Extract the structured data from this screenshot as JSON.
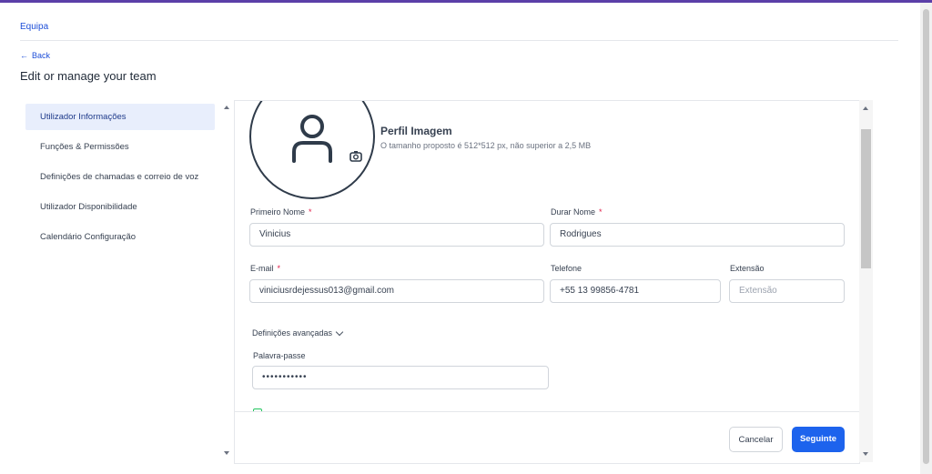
{
  "nav": {
    "tab": "Equipa",
    "back": "Back",
    "page_title": "Edit or manage your team"
  },
  "sidebar": {
    "items": [
      {
        "label": "Utilizador Informações",
        "active": true
      },
      {
        "label": "Funções & Permissões",
        "active": false
      },
      {
        "label": "Definições de chamadas e correio de voz",
        "active": false
      },
      {
        "label": "Utilizador Disponibilidade",
        "active": false
      },
      {
        "label": "Calendário Configuração",
        "active": false
      }
    ]
  },
  "profile": {
    "title": "Perfil Imagem",
    "subtitle": "O tamanho proposto é 512*512 px, não superior a 2,5 MB"
  },
  "form": {
    "first_name": {
      "label": "Primeiro Nome",
      "required_mark": "*",
      "value": "Vinicius"
    },
    "last_name": {
      "label": "Durar Nome",
      "required_mark": "*",
      "value": "Rodrigues"
    },
    "email": {
      "label": "E-mail",
      "required_mark": "*",
      "value": "viniciusrdejessus013@gmail.com"
    },
    "phone": {
      "label": "Telefone",
      "value": "+55 13 99856-4781"
    },
    "extension": {
      "label": "Extensão",
      "placeholder": "Extensão"
    },
    "advanced": {
      "label": "Definições avançadas"
    },
    "password": {
      "label": "Palavra-passe",
      "value": "•••••••••••"
    }
  },
  "footer": {
    "cancel": "Cancelar",
    "next": "Seguinte"
  },
  "colors": {
    "accent": "#1d63ed",
    "active_bg": "#e8eefc",
    "required": "#e11d48",
    "checkbox": "#22c55e"
  }
}
